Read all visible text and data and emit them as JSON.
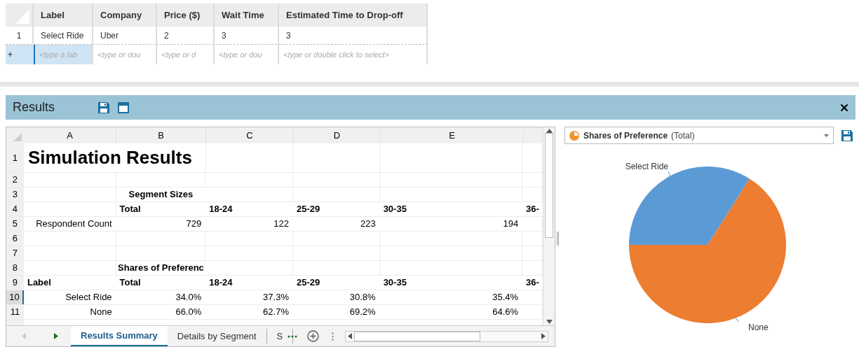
{
  "grid": {
    "columns": [
      "Label",
      "Company",
      "Price ($)",
      "Wait Time",
      "Estimated Time to Drop-off"
    ],
    "rows": [
      {
        "number": "1",
        "cells": [
          "Select Ride",
          "Uber",
          "2",
          "3",
          "3"
        ]
      }
    ],
    "new_row": {
      "marker": "+",
      "cells": [
        {
          "placeholder": "<type a lab",
          "selected": true
        },
        {
          "placeholder": "<type or dou",
          "selected": false
        },
        {
          "placeholder": "<type or d",
          "selected": false
        },
        {
          "placeholder": "<type or dou",
          "selected": false
        },
        {
          "placeholder": "<type or double click to select>",
          "selected": false
        }
      ]
    }
  },
  "results_panel": {
    "title": "Results",
    "spreadsheet": {
      "columns": [
        "A",
        "B",
        "C",
        "D",
        "E"
      ],
      "rows": [
        {
          "number": "1",
          "selected": false,
          "cells": [
            {
              "text": "Simulation Results",
              "kind": "title"
            }
          ]
        },
        {
          "number": "2",
          "selected": false,
          "cells": []
        },
        {
          "number": "3",
          "selected": false,
          "cells": [
            {
              "text": ""
            },
            {
              "text": "Segment Sizes",
              "kind": "section"
            }
          ]
        },
        {
          "number": "4",
          "selected": false,
          "cells": [
            {
              "text": ""
            },
            {
              "text": "Total",
              "kind": "head"
            },
            {
              "text": "18-24",
              "kind": "head"
            },
            {
              "text": "25-29",
              "kind": "head"
            },
            {
              "text": "30-35",
              "kind": "head"
            },
            {
              "text": "36-",
              "kind": "head"
            }
          ]
        },
        {
          "number": "5",
          "selected": false,
          "cells": [
            {
              "text": "Respondent Count",
              "kind": "label"
            },
            {
              "text": "729",
              "kind": "number"
            },
            {
              "text": "122",
              "kind": "number"
            },
            {
              "text": "223",
              "kind": "number"
            },
            {
              "text": "194",
              "kind": "number"
            }
          ]
        },
        {
          "number": "6",
          "selected": false,
          "cells": []
        },
        {
          "number": "7",
          "selected": false,
          "cells": []
        },
        {
          "number": "8",
          "selected": false,
          "cells": [
            {
              "text": ""
            },
            {
              "text": "Shares of Preferenc",
              "kind": "section"
            }
          ]
        },
        {
          "number": "9",
          "selected": false,
          "cells": [
            {
              "text": "Label",
              "kind": "head"
            },
            {
              "text": "Total",
              "kind": "head"
            },
            {
              "text": "18-24",
              "kind": "head"
            },
            {
              "text": "25-29",
              "kind": "head"
            },
            {
              "text": "30-35",
              "kind": "head"
            },
            {
              "text": "36-",
              "kind": "head"
            }
          ]
        },
        {
          "number": "10",
          "selected": true,
          "cells": [
            {
              "text": "Select Ride",
              "kind": "label"
            },
            {
              "text": "34.0%",
              "kind": "number"
            },
            {
              "text": "37.3%",
              "kind": "number"
            },
            {
              "text": "30.8%",
              "kind": "number"
            },
            {
              "text": "35.4%",
              "kind": "number"
            }
          ]
        },
        {
          "number": "11",
          "selected": false,
          "cells": [
            {
              "text": "None",
              "kind": "label"
            },
            {
              "text": "66.0%",
              "kind": "number"
            },
            {
              "text": "62.7%",
              "kind": "number"
            },
            {
              "text": "69.2%",
              "kind": "number"
            },
            {
              "text": "64.6%",
              "kind": "number"
            }
          ]
        }
      ],
      "sheet_tabs": [
        {
          "label": "Results Summary",
          "selected": true
        },
        {
          "label": "Details by Segment",
          "selected": false
        },
        {
          "label": "S",
          "selected": false
        }
      ]
    },
    "chart_panel": {
      "selector": {
        "title": "Shares of Preference",
        "subtitle": "(Total)"
      },
      "chart_data": {
        "type": "pie",
        "categories": [
          "Select Ride",
          "None"
        ],
        "values": [
          34.0,
          66.0
        ]
      }
    }
  }
}
